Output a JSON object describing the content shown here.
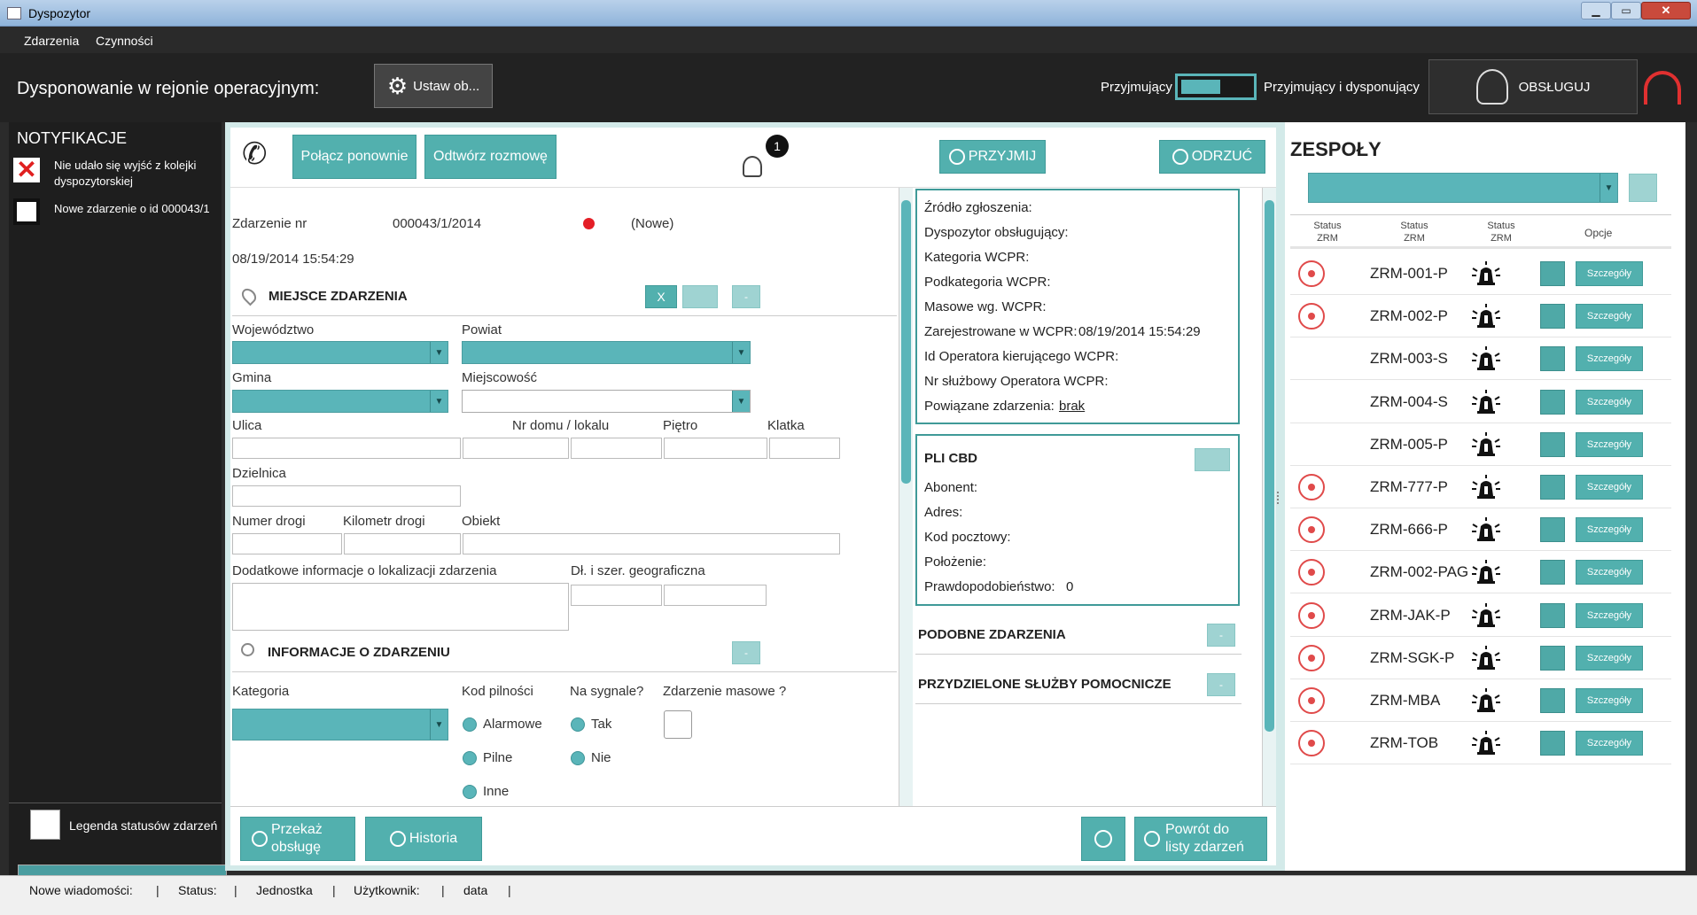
{
  "window": {
    "title": "Dyspozytor"
  },
  "menu": {
    "items": [
      "Zdarzenia",
      "Czynności"
    ]
  },
  "header": {
    "region_label": "Dysponowanie w rejonie operacyjnym:",
    "set_button": "Ustaw ob...",
    "toggle_left": "Przyjmujący",
    "toggle_right": "Przyjmujący i dysponujący",
    "serve_button": "OBSŁUGUJ"
  },
  "notifications": {
    "title": "NOTYFIKACJE",
    "items": [
      {
        "text": "Nie udało się wyjść z kolejki dyspozytorskiej",
        "icon": "error-x-icon"
      },
      {
        "text": "Nowe zdarzenie o id 000043/1",
        "icon": "envelope-icon"
      }
    ],
    "legend": "Legenda statusów zdarzeń"
  },
  "call_bar": {
    "reconnect": "Połącz ponownie",
    "replay": "Odtwórz rozmowę",
    "badge": "1",
    "accept": "PRZYJMIJ",
    "reject": "ODRZUĆ"
  },
  "event": {
    "number_label": "Zdarzenie nr",
    "number": "000043/1/2014",
    "status": "(Nowe)",
    "datetime": "08/19/2014 15:54:29",
    "status_color": "#e41e26"
  },
  "location": {
    "title": "MIEJSCE ZDARZENIA",
    "x_button": "X",
    "minus": "-",
    "voivodeship": "Województwo",
    "county": "Powiat",
    "commune": "Gmina",
    "town": "Miejscowość",
    "street": "Ulica",
    "house_no": "Nr domu / lokalu",
    "floor": "Piętro",
    "staircase": "Klatka",
    "district": "Dzielnica",
    "road_no": "Numer drogi",
    "road_km": "Kilometr drogi",
    "object": "Obiekt",
    "extra_info": "Dodatkowe informacje o lokalizacji zdarzenia",
    "geo": "Dł. i szer. geograficzna"
  },
  "incident_info": {
    "title": "INFORMACJE O ZDARZENIU",
    "minus": "-",
    "category": "Kategoria",
    "urgency": "Kod pilności",
    "urgency_options": [
      "Alarmowe",
      "Pilne",
      "Inne"
    ],
    "signal": "Na sygnale?",
    "signal_options": [
      "Tak",
      "Nie"
    ],
    "mass": "Zdarzenie masowe ?"
  },
  "wcpr": {
    "source": "Źródło zgłoszenia:",
    "dispatcher": "Dyspozytor obsługujący:",
    "category": "Kategoria WCPR:",
    "subcategory": "Podkategoria WCPR:",
    "mass": "Masowe wg. WCPR:",
    "registered_label": "Zarejestrowane w WCPR:",
    "registered_value": "08/19/2014 15:54:29",
    "operator_id": "Id Operatora kierującego WCPR:",
    "operator_no": "Nr służbowy Operatora WCPR:",
    "related_label": "Powiązane zdarzenia:",
    "related_value": "brak"
  },
  "pli": {
    "title": "PLI CBD",
    "subscriber": "Abonent:",
    "address": "Adres:",
    "postal": "Kod pocztowy:",
    "position": "Położenie:",
    "probability_label": "Prawdopodobieństwo:",
    "probability_value": "0"
  },
  "similar": {
    "title": "PODOBNE ZDARZENIA",
    "minus": "-"
  },
  "assigned": {
    "title": "PRZYDZIELONE SŁUŻBY POMOCNICZE",
    "minus": "-"
  },
  "bottom_buttons": {
    "transfer": "Przekaż obsługę",
    "history": "Historia",
    "back": "Powrót do listy zdarzeń"
  },
  "teams": {
    "title": "ZESPOŁY",
    "columns": [
      "Status ZRM",
      "Status ZRM",
      "Status ZRM",
      "Opcje"
    ],
    "details_label": "Szczegóły",
    "rows": [
      {
        "name": "ZRM-001-P",
        "rec": true
      },
      {
        "name": "ZRM-002-P",
        "rec": true
      },
      {
        "name": "ZRM-003-S",
        "rec": false
      },
      {
        "name": "ZRM-004-S",
        "rec": false
      },
      {
        "name": "ZRM-005-P",
        "rec": false
      },
      {
        "name": "ZRM-777-P",
        "rec": true
      },
      {
        "name": "ZRM-666-P",
        "rec": true
      },
      {
        "name": "ZRM-002-PAG",
        "rec": true
      },
      {
        "name": "ZRM-JAK-P",
        "rec": true
      },
      {
        "name": "ZRM-SGK-P",
        "rec": true
      },
      {
        "name": "ZRM-MBA",
        "rec": true
      },
      {
        "name": "ZRM-TOB",
        "rec": true
      }
    ]
  },
  "statusbar": {
    "new_messages": "Nowe wiadomości:",
    "status": "Status:",
    "unit": "Jednostka",
    "user": "Użytkownik:",
    "date": "data"
  }
}
